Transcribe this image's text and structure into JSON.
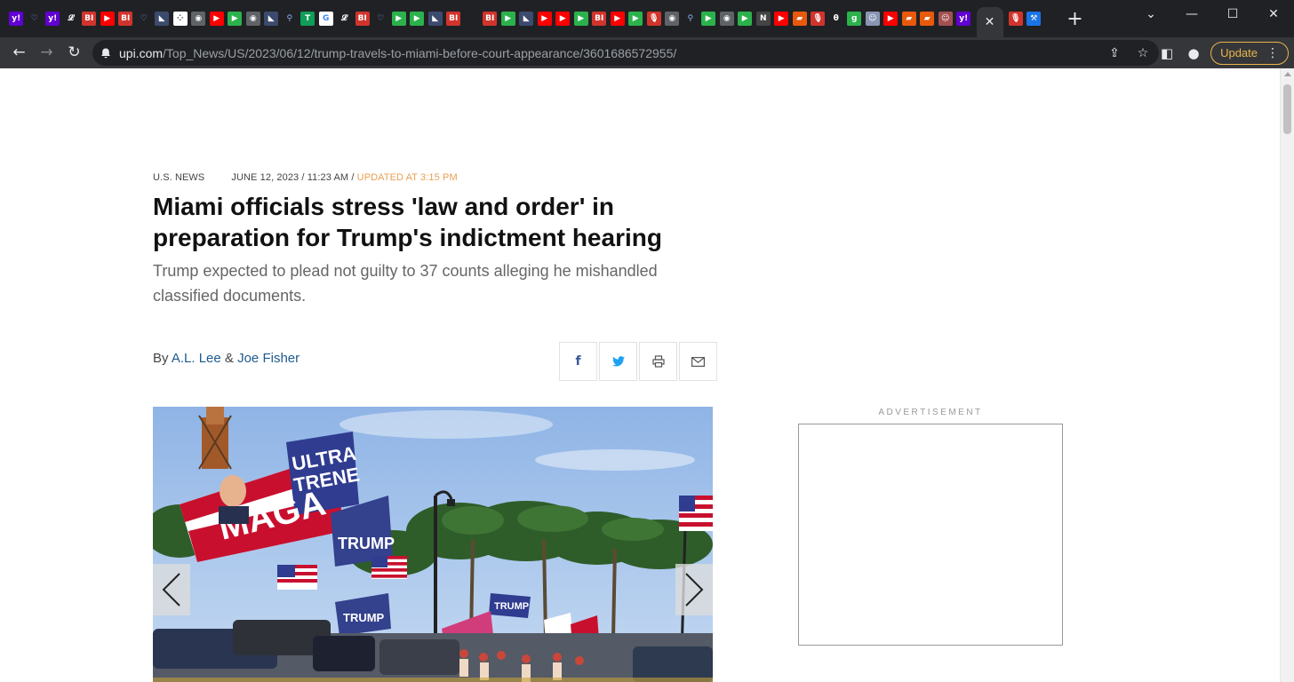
{
  "browser": {
    "tab_favicons": [
      {
        "icon": "yahoo-icon",
        "glyph": "y!",
        "bg": "#6001d2"
      },
      {
        "icon": "heart-icon",
        "glyph": "♡",
        "bg": "#202124",
        "fg": "#7aa7ff"
      },
      {
        "icon": "yahoo-icon",
        "glyph": "y!",
        "bg": "#6001d2"
      },
      {
        "icon": "latimes-icon",
        "glyph": "𝓛",
        "bg": "#202124"
      },
      {
        "icon": "bi-icon",
        "glyph": "BI",
        "bg": "#d0342c"
      },
      {
        "icon": "youtube-icon",
        "glyph": "▶",
        "bg": "#ff0000"
      },
      {
        "icon": "bi-icon",
        "glyph": "BI",
        "bg": "#d0342c"
      },
      {
        "icon": "heart-icon",
        "glyph": "♡",
        "bg": "#202124",
        "fg": "#7aa7ff"
      },
      {
        "icon": "bookmark-icon",
        "glyph": "◣",
        "bg": "#3c4a6e"
      },
      {
        "icon": "dots-icon",
        "glyph": "⁘",
        "bg": "#ffffff",
        "fg": "#333333"
      },
      {
        "icon": "globe-icon",
        "glyph": "◉",
        "bg": "#5f6368"
      },
      {
        "icon": "youtube-icon",
        "glyph": "▶",
        "bg": "#ff0000"
      },
      {
        "icon": "play-icon",
        "glyph": "▶",
        "bg": "#2bb24c"
      },
      {
        "icon": "globe-icon",
        "glyph": "◉",
        "bg": "#5f6368"
      },
      {
        "icon": "bookmark-icon",
        "glyph": "◣",
        "bg": "#3c4a6e"
      },
      {
        "icon": "search-icon",
        "glyph": "⚲",
        "bg": "#202124",
        "fg": "#8ab4f8"
      },
      {
        "icon": "t-icon",
        "glyph": "T",
        "bg": "#0f9d58"
      },
      {
        "icon": "google-icon",
        "glyph": "G",
        "bg": "#ffffff",
        "fg": "#4285f4"
      },
      {
        "icon": "latimes-icon",
        "glyph": "𝓛",
        "bg": "#202124"
      },
      {
        "icon": "bi-icon",
        "glyph": "BI",
        "bg": "#d0342c"
      },
      {
        "icon": "heart-icon",
        "glyph": "♡",
        "bg": "#202124",
        "fg": "#7aa7ff"
      },
      {
        "icon": "play-icon",
        "glyph": "▶",
        "bg": "#2bb24c"
      },
      {
        "icon": "play-icon",
        "glyph": "▶",
        "bg": "#2bb24c"
      },
      {
        "icon": "bookmark-icon",
        "glyph": "◣",
        "bg": "#3c4a6e"
      },
      {
        "icon": "bi-icon",
        "glyph": "BI",
        "bg": "#d0342c"
      },
      {
        "icon": "blank-icon",
        "glyph": "",
        "bg": "#202124"
      },
      {
        "icon": "bi-icon",
        "glyph": "BI",
        "bg": "#d0342c"
      },
      {
        "icon": "play-icon",
        "glyph": "▶",
        "bg": "#2bb24c"
      },
      {
        "icon": "bookmark-icon",
        "glyph": "◣",
        "bg": "#3c4a6e"
      },
      {
        "icon": "youtube-icon",
        "glyph": "▶",
        "bg": "#ff0000"
      },
      {
        "icon": "youtube-icon",
        "glyph": "▶",
        "bg": "#ff0000"
      },
      {
        "icon": "play-icon",
        "glyph": "▶",
        "bg": "#2bb24c"
      },
      {
        "icon": "bi-icon",
        "glyph": "BI",
        "bg": "#d0342c"
      },
      {
        "icon": "youtube-icon",
        "glyph": "▶",
        "bg": "#ff0000"
      },
      {
        "icon": "play-icon",
        "glyph": "▶",
        "bg": "#2bb24c"
      },
      {
        "icon": "mic-icon",
        "glyph": "🎙",
        "bg": "#d0342c"
      },
      {
        "icon": "globe-icon",
        "glyph": "◉",
        "bg": "#5f6368"
      },
      {
        "icon": "search-icon",
        "glyph": "⚲",
        "bg": "#202124",
        "fg": "#8ab4f8"
      },
      {
        "icon": "play-icon",
        "glyph": "▶",
        "bg": "#2bb24c"
      },
      {
        "icon": "globe-icon",
        "glyph": "◉",
        "bg": "#5f6368"
      },
      {
        "icon": "play-icon",
        "glyph": "▶",
        "bg": "#2bb24c"
      },
      {
        "icon": "news-icon",
        "glyph": "N",
        "bg": "#444444"
      },
      {
        "icon": "youtube-icon",
        "glyph": "▶",
        "bg": "#ff0000"
      },
      {
        "icon": "flag-icon",
        "glyph": "▰",
        "bg": "#e8590c"
      },
      {
        "icon": "mic-icon",
        "glyph": "🎙",
        "bg": "#d0342c"
      },
      {
        "icon": "theta-icon",
        "glyph": "θ",
        "bg": "#202124"
      },
      {
        "icon": "g-icon",
        "glyph": "g",
        "bg": "#2bb24c"
      },
      {
        "icon": "portrait-icon",
        "glyph": "☺",
        "bg": "#8895b3"
      },
      {
        "icon": "youtube-icon",
        "glyph": "▶",
        "bg": "#ff0000"
      },
      {
        "icon": "flag-icon",
        "glyph": "▰",
        "bg": "#e8590c"
      },
      {
        "icon": "flag-icon",
        "glyph": "▰",
        "bg": "#e8590c"
      },
      {
        "icon": "portrait-icon",
        "glyph": "☺",
        "bg": "#a35050"
      },
      {
        "icon": "yahoo-icon",
        "glyph": "y!",
        "bg": "#6001d2"
      }
    ],
    "active_tab_close": "✕",
    "after_tabs": [
      {
        "icon": "mic-icon",
        "glyph": "🎙",
        "bg": "#d0342c"
      },
      {
        "icon": "tool-icon",
        "glyph": "⚒",
        "bg": "#1a73e8"
      }
    ],
    "new_tab": "+",
    "window": {
      "minimize": "—",
      "maximize": "☐",
      "close": "✕",
      "tab_search": "⌄"
    },
    "url_host": "upi.com",
    "url_path": "/Top_News/US/2023/06/12/trump-travels-to-miami-before-court-appearance/3601686572955/",
    "update_label": "Update"
  },
  "article": {
    "category": "U.S. NEWS",
    "date": "JUNE 12, 2023 / 11:23 AM / ",
    "updated": "UPDATED AT 3:15 PM",
    "headline": "Miami officials stress 'law and order' in preparation for Trump's indictment hearing",
    "dek": "Trump expected to plead not guilty to 37 counts alleging he mishandled classified documents.",
    "by_prefix": "By ",
    "author1": "A.L. Lee",
    "author_sep": " & ",
    "author2": "Joe Fisher",
    "share": {
      "facebook": "f",
      "twitter": "🐦",
      "print": "⎙",
      "email": "✉"
    },
    "photo_flag_texts": [
      "ULTRA",
      "TRENE",
      "MAGA",
      "TRUMP",
      "TRUMP",
      "TRUMP"
    ]
  },
  "sidebar": {
    "ad_label": "ADVERTISEMENT"
  },
  "colors": {
    "accent_updated": "#e8a050",
    "link": "#1d5b8f",
    "update_button": "#e8b54a"
  }
}
